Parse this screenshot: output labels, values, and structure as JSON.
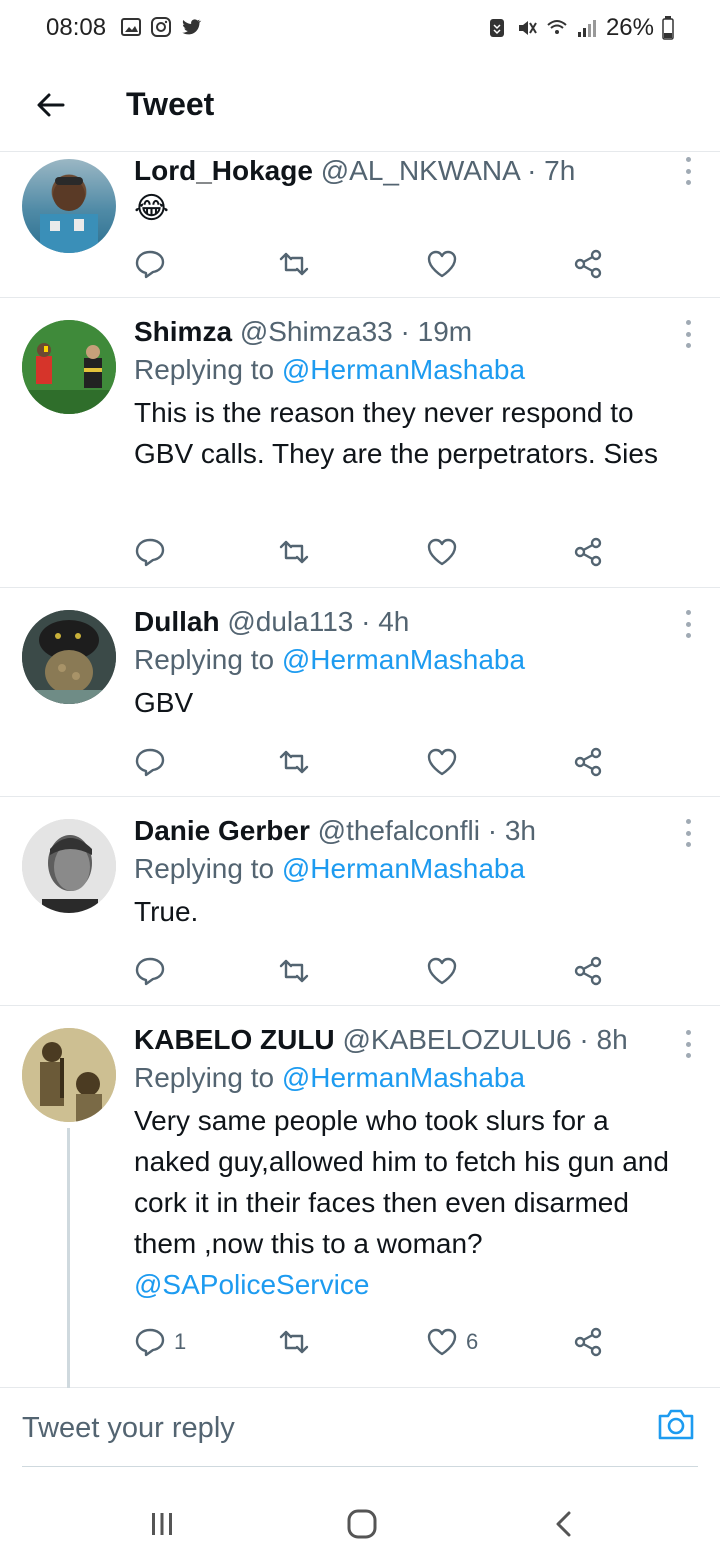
{
  "status_bar": {
    "time": "08:08",
    "battery": "26%",
    "left_icons": [
      "gallery-icon",
      "instagram-icon",
      "twitter-icon"
    ],
    "right_icons": [
      "nfc-icon",
      "mute-icon",
      "wifi-icon",
      "signal-icon",
      "battery-icon"
    ]
  },
  "header": {
    "title": "Tweet"
  },
  "colors": {
    "accent": "#1d9bf0",
    "text_primary": "#0f1419",
    "text_secondary": "#536471",
    "divider": "#e6e9ec"
  },
  "tweets": [
    {
      "name": "Lord_Hokage",
      "handle": "@AL_NKWANA",
      "time": "7h",
      "replying_to": "",
      "text": "😂",
      "mention_text": "",
      "reply_count": "",
      "like_count": ""
    },
    {
      "name": "Shimza",
      "handle": "@Shimza33",
      "time": "19m",
      "replying_prefix": "Replying to",
      "replying_to": "@HermanMashaba",
      "text": "This is the reason they never respond to GBV calls. They are the perpetrators. Sies",
      "reply_count": "",
      "like_count": ""
    },
    {
      "name": "Dullah",
      "handle": "@dula113",
      "time": "4h",
      "replying_prefix": "Replying to",
      "replying_to": "@HermanMashaba",
      "text": "GBV",
      "reply_count": "",
      "like_count": ""
    },
    {
      "name": "Danie Gerber",
      "handle": "@thefalconfli",
      "time": "3h",
      "replying_prefix": "Replying to",
      "replying_to": "@HermanMashaba",
      "text": "True.",
      "reply_count": "",
      "like_count": ""
    },
    {
      "name": "KABELO ZULU",
      "handle": "@KABELOZULU6",
      "time": "8h",
      "replying_prefix": "Replying to",
      "replying_to": "@HermanMashaba",
      "text": "Very same people who took slurs for a naked guy,allowed him to fetch his gun and cork it in their faces then even disarmed them ,now this to a woman?",
      "mention_text": "@SAPoliceService",
      "reply_count": "1",
      "like_count": "6"
    }
  ],
  "separator": "·",
  "composer": {
    "placeholder": "Tweet your reply"
  }
}
